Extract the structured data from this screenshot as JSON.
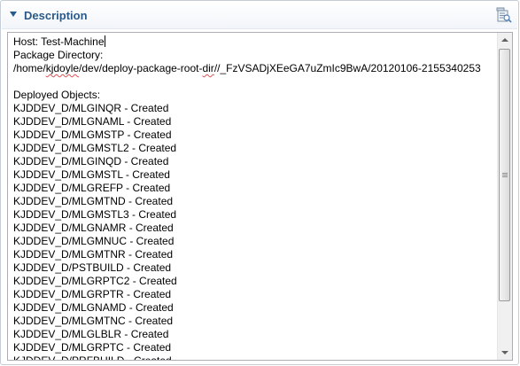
{
  "section": {
    "title": "Description"
  },
  "icons": {
    "expand": "chevron-down-icon",
    "toolbar": "open-in-editor-icon"
  },
  "description": {
    "host_line": "Host: Test-Machine",
    "package_dir_label": "Package Directory:",
    "path_prefix": "/home/",
    "path_user": "kjdoyle",
    "path_mid": "/dev/deploy-package-root-",
    "path_dir": "dir",
    "path_suffix": "//_FzVSADjXEeGA7uZmIc9BwA/20120106-2155340253",
    "deployed_label": "Deployed Objects:",
    "objects": [
      "KJDDEV_D/MLGINQR - Created",
      "KJDDEV_D/MLGNAML - Created",
      "KJDDEV_D/MLGMSTP - Created",
      "KJDDEV_D/MLGMSTL2 - Created",
      "KJDDEV_D/MLGINQD - Created",
      "KJDDEV_D/MLGMSTL - Created",
      "KJDDEV_D/MLGREFP - Created",
      "KJDDEV_D/MLGMTND - Created",
      "KJDDEV_D/MLGMSTL3 - Created",
      "KJDDEV_D/MLGNAMR - Created",
      "KJDDEV_D/MLGMNUC - Created",
      "KJDDEV_D/MLGMTNR - Created",
      "KJDDEV_D/PSTBUILD - Created",
      "KJDDEV_D/MLGRPTC2 - Created",
      "KJDDEV_D/MLGRPTR - Created",
      "KJDDEV_D/MLGNAMD - Created",
      "KJDDEV_D/MLGMTNC - Created",
      "KJDDEV_D/MLGLBLR - Created",
      "KJDDEV_D/MLGRPTC - Created",
      "KJDDEV_D/PRFBUILD - Created"
    ]
  },
  "colors": {
    "title": "#2a5a8a",
    "border": "#c6cdd6"
  }
}
